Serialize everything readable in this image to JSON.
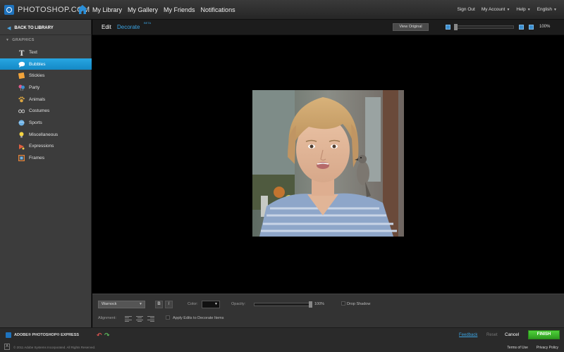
{
  "app": {
    "logo_text": "PHOTOSHOP.COM"
  },
  "nav": {
    "items": [
      "My Library",
      "My Gallery",
      "My Friends",
      "Notifications"
    ]
  },
  "topright": {
    "sign_out": "Sign Out",
    "my_account": "My Account",
    "help": "Help",
    "language": "English"
  },
  "sidebar": {
    "back_label": "BACK TO LIBRARY",
    "section": "GRAPHICS",
    "items": [
      {
        "label": "Text",
        "icon": "text-t-icon",
        "color": "#dddddd"
      },
      {
        "label": "Bubbles",
        "icon": "speech-bubble-icon",
        "color": "#ffffff"
      },
      {
        "label": "Stickies",
        "icon": "sticky-note-icon",
        "color": "#f2a33a"
      },
      {
        "label": "Party",
        "icon": "party-icon",
        "color": "#e05a8a"
      },
      {
        "label": "Animals",
        "icon": "paw-icon",
        "color": "#d9a441"
      },
      {
        "label": "Costumes",
        "icon": "glasses-icon",
        "color": "#cccccc"
      },
      {
        "label": "Sports",
        "icon": "ball-icon",
        "color": "#6db3e8"
      },
      {
        "label": "Miscellaneous",
        "icon": "lightbulb-icon",
        "color": "#f5d442"
      },
      {
        "label": "Expressions",
        "icon": "expression-icon",
        "color": "#e06040"
      },
      {
        "label": "Frames",
        "icon": "frame-icon",
        "color": "#e0823a"
      }
    ],
    "selected_index": 1
  },
  "editor": {
    "tab_edit": "Edit",
    "tab_decorate": "Decorate",
    "beta": "BETA",
    "view_original": "View Original",
    "zoom": "100%"
  },
  "toolbar": {
    "font": "Warnock",
    "bold": "B",
    "italic": "I",
    "color_label": "Color:",
    "opacity_label": "Opacity:",
    "opacity_value": "100%",
    "drop_shadow": "Drop Shadow",
    "alignment_label": "Alignment:",
    "apply_label": "Apply Edits to Decorate Items"
  },
  "footer": {
    "product": "ADOBE® PHOTOSHOP® EXPRESS",
    "copyright": "© 2011 Adobe Systems Incorporated. All Rights Reserved.",
    "feedback": "Feedback",
    "reset": "Reset",
    "cancel": "Cancel",
    "finish": "FINISH",
    "terms": "Terms of Use",
    "privacy": "Privacy Policy"
  },
  "colors": {
    "accent": "#27a6e2",
    "finish_green": "#3bbf2a"
  }
}
